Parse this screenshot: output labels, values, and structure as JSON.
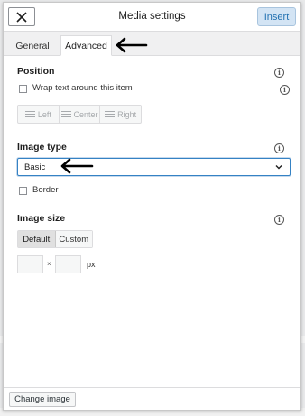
{
  "header": {
    "title": "Media settings",
    "insert_label": "Insert",
    "close_icon": "close-icon"
  },
  "tabs": [
    {
      "label": "General",
      "active": false
    },
    {
      "label": "Advanced",
      "active": true
    }
  ],
  "position": {
    "heading": "Position",
    "wrap_label": "Wrap text around this item",
    "wrap_checked": false,
    "align": [
      "Left",
      "Center",
      "Right"
    ]
  },
  "image_type": {
    "heading": "Image type",
    "selected": "Basic",
    "border_label": "Border",
    "border_checked": false
  },
  "image_size": {
    "heading": "Image size",
    "options": [
      "Default",
      "Custom"
    ],
    "selected": "Default",
    "width": "",
    "height": "",
    "times": "×",
    "unit": "px"
  },
  "footer": {
    "change_label": "Change image"
  },
  "colors": {
    "accent": "#2271b1",
    "insert_bg": "#d3e4f4",
    "focus_border": "#3582c4"
  }
}
